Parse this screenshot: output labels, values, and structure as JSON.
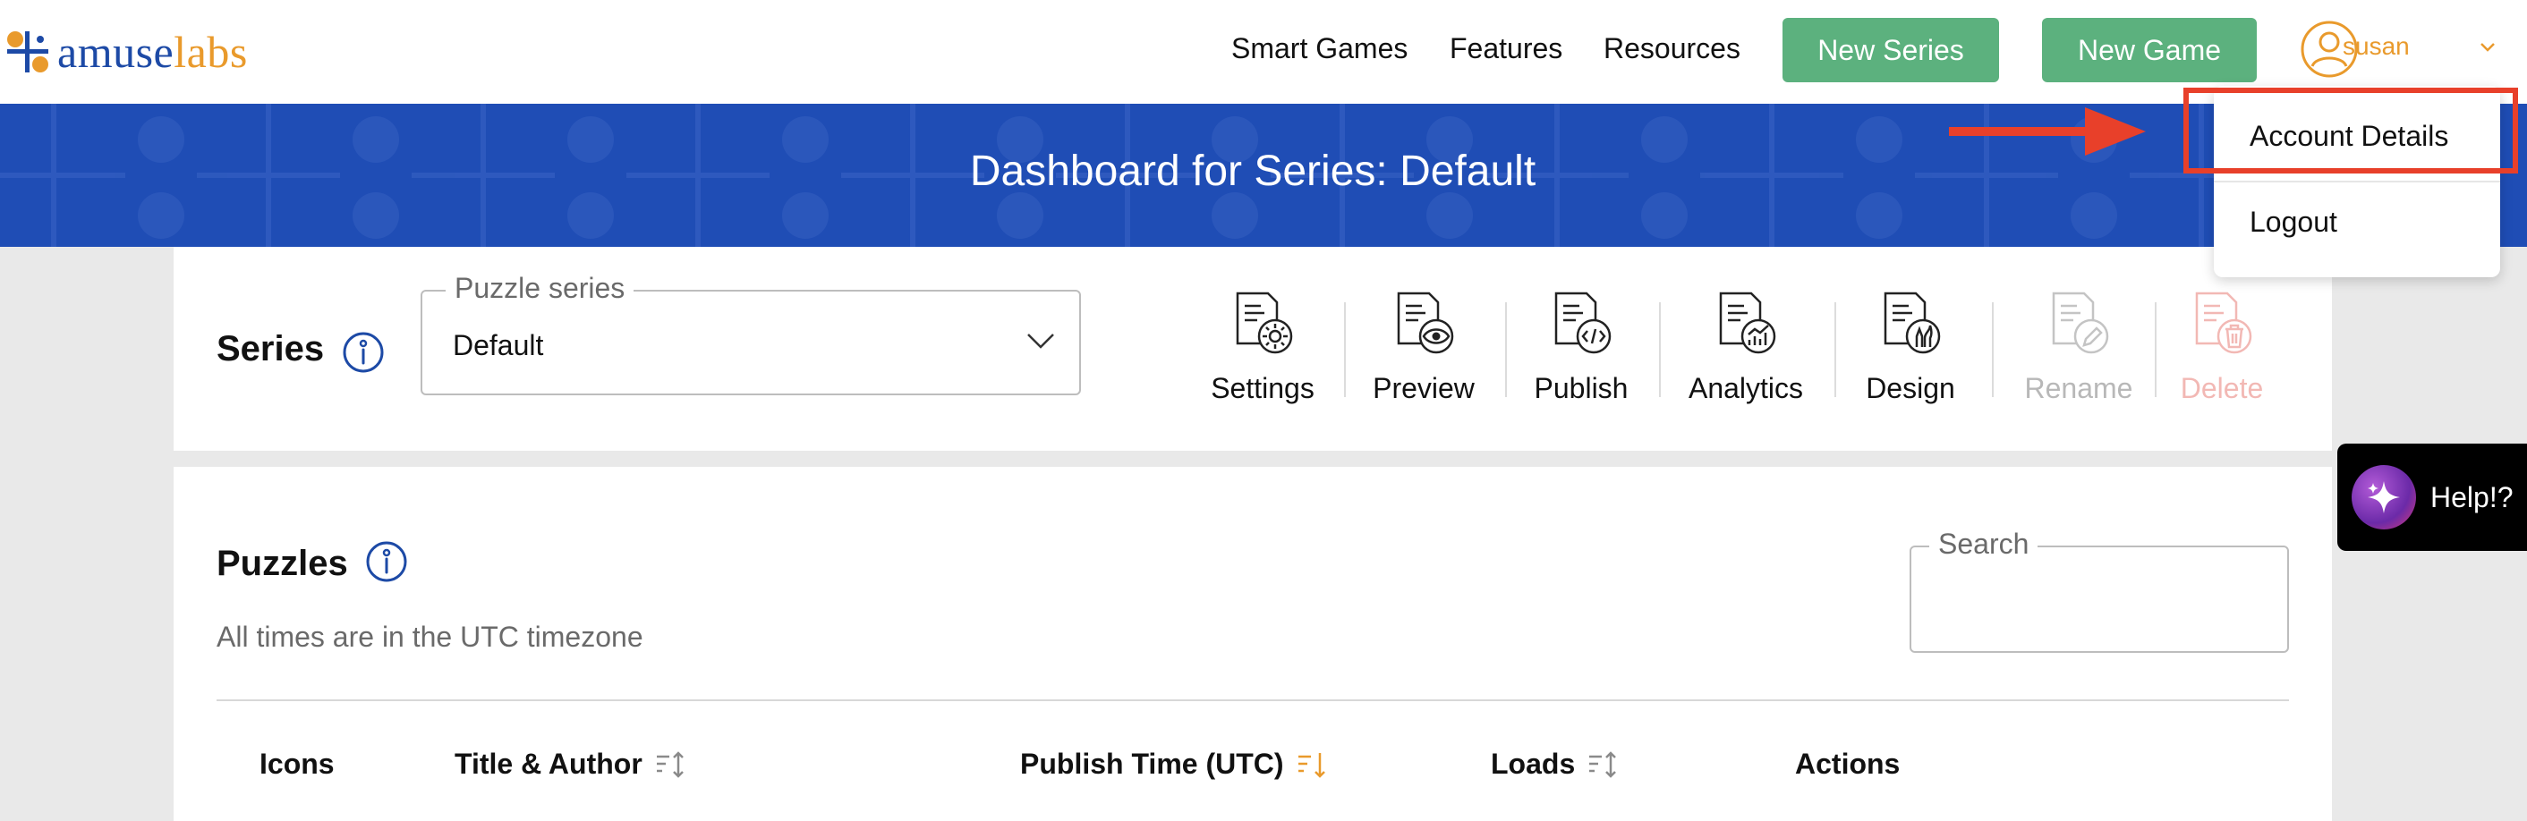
{
  "brand": {
    "part1": "amuse",
    "part2": "labs"
  },
  "nav": {
    "links": [
      "Smart Games",
      "Features",
      "Resources"
    ],
    "new_series_label": "New Series",
    "new_game_label": "New Game",
    "username": "susan"
  },
  "user_menu": {
    "items": [
      "Account Details",
      "Logout"
    ],
    "highlighted": "Account Details"
  },
  "banner": {
    "title": "Dashboard for Series: Default"
  },
  "series": {
    "heading": "Series",
    "select_legend": "Puzzle series",
    "select_value": "Default",
    "tools": [
      {
        "label": "Settings",
        "icon": "doc-gear-icon",
        "state": "enabled"
      },
      {
        "label": "Preview",
        "icon": "doc-eye-icon",
        "state": "enabled"
      },
      {
        "label": "Publish",
        "icon": "doc-code-icon",
        "state": "enabled"
      },
      {
        "label": "Analytics",
        "icon": "doc-chart-icon",
        "state": "enabled"
      },
      {
        "label": "Design",
        "icon": "doc-brush-icon",
        "state": "enabled"
      },
      {
        "label": "Rename",
        "icon": "doc-pencil-icon",
        "state": "disabled"
      },
      {
        "label": "Delete",
        "icon": "doc-trash-icon",
        "state": "disabled"
      }
    ]
  },
  "puzzles": {
    "heading": "Puzzles",
    "timezone_note": "All times are in the UTC timezone",
    "search_legend": "Search",
    "columns": [
      "Icons",
      "Title & Author",
      "Publish Time (UTC)",
      "Loads",
      "Actions"
    ],
    "active_sort_column": "Publish Time (UTC)"
  },
  "help": {
    "label": "Help!?"
  },
  "colors": {
    "brand_blue": "#1d4aa6",
    "brand_orange": "#e99a2c",
    "button_green": "#5cb17e",
    "banner_blue": "#1f4db5",
    "annotation_red": "#e8402a"
  }
}
